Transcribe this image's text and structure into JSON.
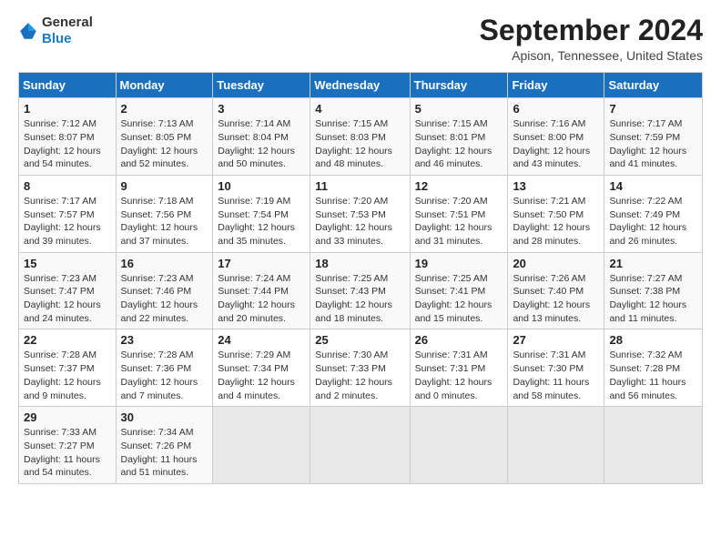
{
  "logo": {
    "text_general": "General",
    "text_blue": "Blue"
  },
  "title": "September 2024",
  "subtitle": "Apison, Tennessee, United States",
  "calendar": {
    "headers": [
      "Sunday",
      "Monday",
      "Tuesday",
      "Wednesday",
      "Thursday",
      "Friday",
      "Saturday"
    ],
    "weeks": [
      [
        {
          "day": "",
          "info": ""
        },
        {
          "day": "2",
          "info": "Sunrise: 7:13 AM\nSunset: 8:05 PM\nDaylight: 12 hours\nand 52 minutes."
        },
        {
          "day": "3",
          "info": "Sunrise: 7:14 AM\nSunset: 8:04 PM\nDaylight: 12 hours\nand 50 minutes."
        },
        {
          "day": "4",
          "info": "Sunrise: 7:15 AM\nSunset: 8:03 PM\nDaylight: 12 hours\nand 48 minutes."
        },
        {
          "day": "5",
          "info": "Sunrise: 7:15 AM\nSunset: 8:01 PM\nDaylight: 12 hours\nand 46 minutes."
        },
        {
          "day": "6",
          "info": "Sunrise: 7:16 AM\nSunset: 8:00 PM\nDaylight: 12 hours\nand 43 minutes."
        },
        {
          "day": "7",
          "info": "Sunrise: 7:17 AM\nSunset: 7:59 PM\nDaylight: 12 hours\nand 41 minutes."
        }
      ],
      [
        {
          "day": "1",
          "info": "Sunrise: 7:12 AM\nSunset: 8:07 PM\nDaylight: 12 hours\nand 54 minutes."
        },
        {
          "day": "9",
          "info": "Sunrise: 7:18 AM\nSunset: 7:56 PM\nDaylight: 12 hours\nand 37 minutes."
        },
        {
          "day": "10",
          "info": "Sunrise: 7:19 AM\nSunset: 7:54 PM\nDaylight: 12 hours\nand 35 minutes."
        },
        {
          "day": "11",
          "info": "Sunrise: 7:20 AM\nSunset: 7:53 PM\nDaylight: 12 hours\nand 33 minutes."
        },
        {
          "day": "12",
          "info": "Sunrise: 7:20 AM\nSunset: 7:51 PM\nDaylight: 12 hours\nand 31 minutes."
        },
        {
          "day": "13",
          "info": "Sunrise: 7:21 AM\nSunset: 7:50 PM\nDaylight: 12 hours\nand 28 minutes."
        },
        {
          "day": "14",
          "info": "Sunrise: 7:22 AM\nSunset: 7:49 PM\nDaylight: 12 hours\nand 26 minutes."
        }
      ],
      [
        {
          "day": "8",
          "info": "Sunrise: 7:17 AM\nSunset: 7:57 PM\nDaylight: 12 hours\nand 39 minutes."
        },
        {
          "day": "16",
          "info": "Sunrise: 7:23 AM\nSunset: 7:46 PM\nDaylight: 12 hours\nand 22 minutes."
        },
        {
          "day": "17",
          "info": "Sunrise: 7:24 AM\nSunset: 7:44 PM\nDaylight: 12 hours\nand 20 minutes."
        },
        {
          "day": "18",
          "info": "Sunrise: 7:25 AM\nSunset: 7:43 PM\nDaylight: 12 hours\nand 18 minutes."
        },
        {
          "day": "19",
          "info": "Sunrise: 7:25 AM\nSunset: 7:41 PM\nDaylight: 12 hours\nand 15 minutes."
        },
        {
          "day": "20",
          "info": "Sunrise: 7:26 AM\nSunset: 7:40 PM\nDaylight: 12 hours\nand 13 minutes."
        },
        {
          "day": "21",
          "info": "Sunrise: 7:27 AM\nSunset: 7:38 PM\nDaylight: 12 hours\nand 11 minutes."
        }
      ],
      [
        {
          "day": "15",
          "info": "Sunrise: 7:23 AM\nSunset: 7:47 PM\nDaylight: 12 hours\nand 24 minutes."
        },
        {
          "day": "23",
          "info": "Sunrise: 7:28 AM\nSunset: 7:36 PM\nDaylight: 12 hours\nand 7 minutes."
        },
        {
          "day": "24",
          "info": "Sunrise: 7:29 AM\nSunset: 7:34 PM\nDaylight: 12 hours\nand 4 minutes."
        },
        {
          "day": "25",
          "info": "Sunrise: 7:30 AM\nSunset: 7:33 PM\nDaylight: 12 hours\nand 2 minutes."
        },
        {
          "day": "26",
          "info": "Sunrise: 7:31 AM\nSunset: 7:31 PM\nDaylight: 12 hours\nand 0 minutes."
        },
        {
          "day": "27",
          "info": "Sunrise: 7:31 AM\nSunset: 7:30 PM\nDaylight: 11 hours\nand 58 minutes."
        },
        {
          "day": "28",
          "info": "Sunrise: 7:32 AM\nSunset: 7:28 PM\nDaylight: 11 hours\nand 56 minutes."
        }
      ],
      [
        {
          "day": "22",
          "info": "Sunrise: 7:28 AM\nSunset: 7:37 PM\nDaylight: 12 hours\nand 9 minutes."
        },
        {
          "day": "30",
          "info": "Sunrise: 7:34 AM\nSunset: 7:26 PM\nDaylight: 11 hours\nand 51 minutes."
        },
        {
          "day": "",
          "info": ""
        },
        {
          "day": "",
          "info": ""
        },
        {
          "day": "",
          "info": ""
        },
        {
          "day": "",
          "info": ""
        },
        {
          "day": "",
          "info": ""
        }
      ],
      [
        {
          "day": "29",
          "info": "Sunrise: 7:33 AM\nSunset: 7:27 PM\nDaylight: 11 hours\nand 54 minutes."
        },
        {
          "day": "",
          "info": ""
        },
        {
          "day": "",
          "info": ""
        },
        {
          "day": "",
          "info": ""
        },
        {
          "day": "",
          "info": ""
        },
        {
          "day": "",
          "info": ""
        },
        {
          "day": "",
          "info": ""
        }
      ]
    ]
  }
}
